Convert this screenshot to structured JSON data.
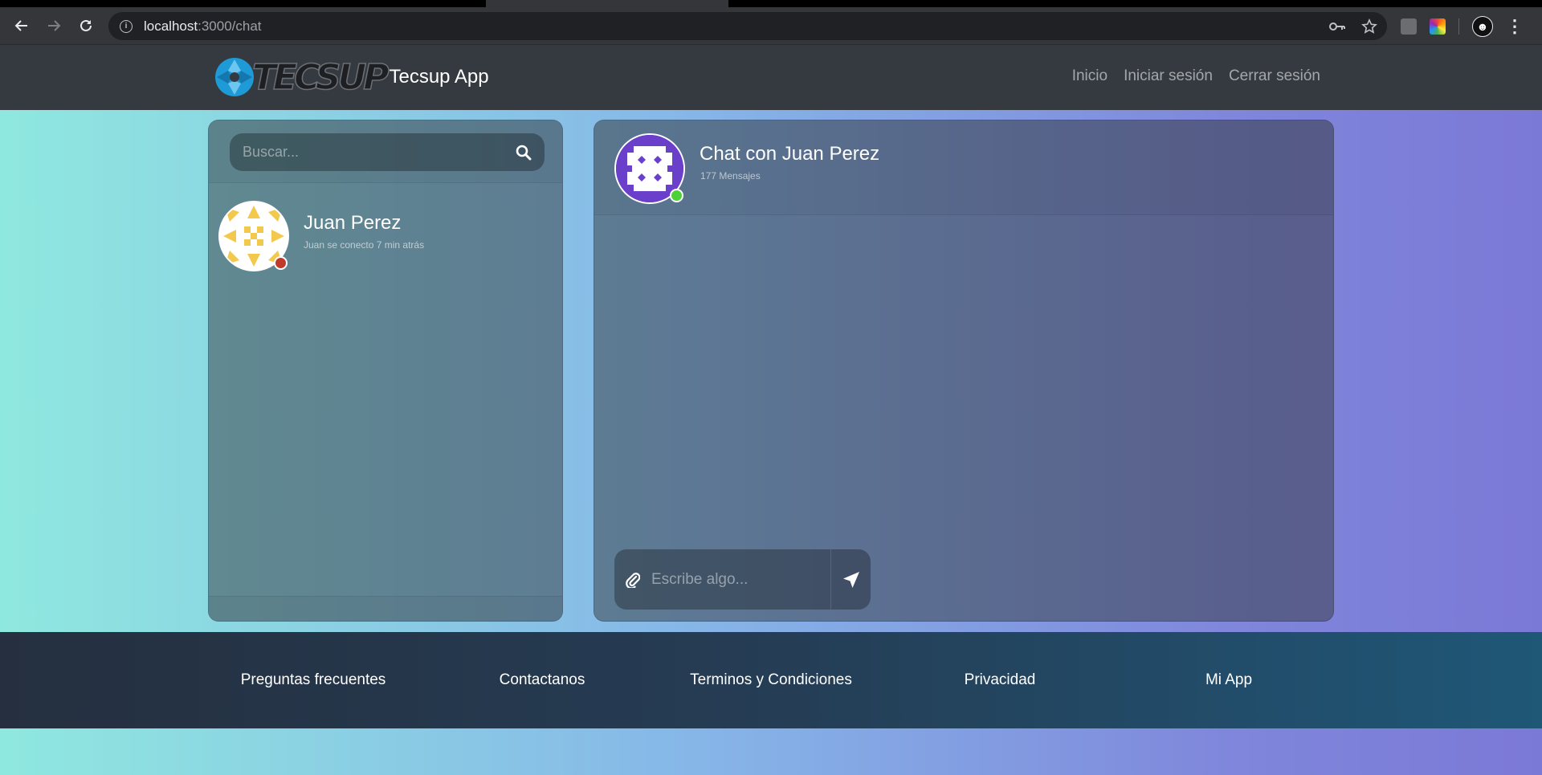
{
  "browser": {
    "url_host": "localhost",
    "url_path": ":3000/chat"
  },
  "navbar": {
    "logo_text": "TECSUP",
    "brand_name": "Tecsup App",
    "links": [
      "Inicio",
      "Iniciar sesión",
      "Cerrar sesión"
    ]
  },
  "contacts": {
    "search_placeholder": "Buscar...",
    "items": [
      {
        "name": "Juan Perez",
        "status_text": "Juan se conecto 7 min atrás",
        "online": false,
        "status_color": "#c0392b"
      }
    ]
  },
  "chat": {
    "title": "Chat con Juan Perez",
    "message_count": "177 Mensajes",
    "online": true,
    "status_color": "#4cd137",
    "composer_placeholder": "Escribe algo..."
  },
  "footer": {
    "links": [
      "Preguntas frecuentes",
      "Contactanos",
      "Terminos y Condiciones",
      "Privacidad",
      "Mi App"
    ]
  },
  "icons": {
    "back": "arrow-left-icon",
    "forward": "arrow-right-icon",
    "reload": "reload-icon",
    "info": "info-icon",
    "key": "key-icon",
    "star": "star-icon",
    "search": "search-icon",
    "attach": "paperclip-icon",
    "send": "paper-plane-icon"
  }
}
